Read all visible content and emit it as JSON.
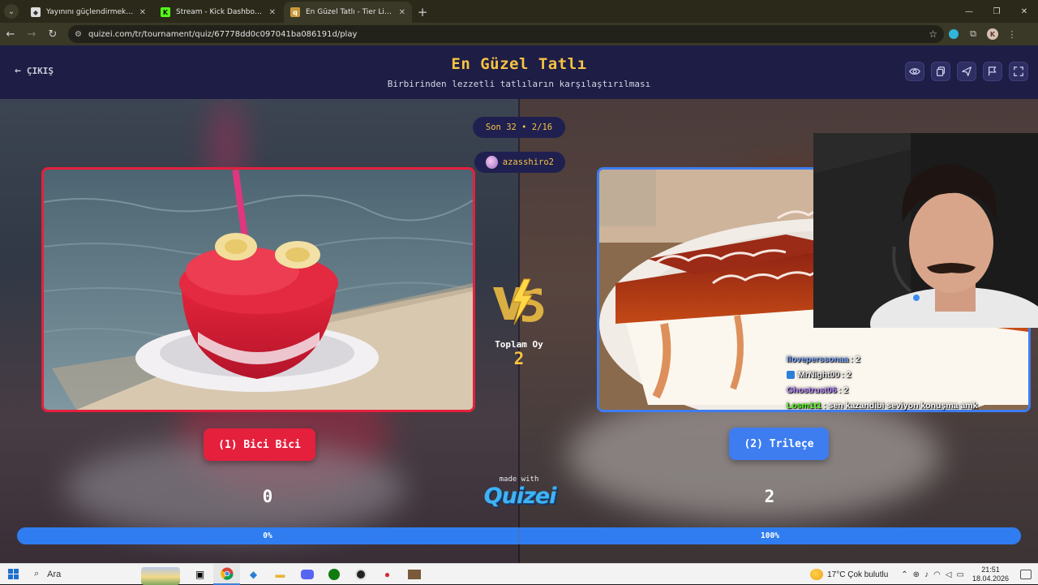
{
  "browser": {
    "tabs": [
      {
        "title": "Yayınını güçlendirmek için en iyi...",
        "favicon": "shield-icon",
        "active": false
      },
      {
        "title": "Stream - Kick Dashboard",
        "favicon": "kick-icon",
        "active": false
      },
      {
        "title": "En Güzel Tatlı - Tier List, Kör Sa...",
        "favicon": "quizei-icon",
        "active": true
      }
    ],
    "url": "quizei.com/tr/tournament/quiz/67778dd0c097041ba086191d/play"
  },
  "header": {
    "exit_label": "ÇIKIŞ",
    "title": "En Güzel Tatlı",
    "subtitle": "Birbirinden lezzetli tatlıların karşılaştırılması",
    "tools": [
      "eye-icon",
      "copy-icon",
      "send-icon",
      "flag-icon",
      "fullscreen-icon"
    ]
  },
  "match": {
    "round": "Son 32 • 2/16",
    "username": "azasshiro2",
    "total_label": "Toplam Oy",
    "total_votes": "2",
    "left": {
      "label": "(1) Bici Bici",
      "score": "0",
      "percent": "0%",
      "share": 0
    },
    "right": {
      "label": "(2) Trileçe",
      "score": "2",
      "percent": "100%",
      "share": 1
    }
  },
  "branding": {
    "made_with": "made with",
    "name": "Quizei"
  },
  "chat": [
    {
      "user": "Iloveperssonaa",
      "text": ": 2",
      "color": "#7aa7ff",
      "badge": false
    },
    {
      "user": "MrNight00",
      "text": ": 2",
      "color": "#f0f0f0",
      "badge": true
    },
    {
      "user": "Ghostrust06",
      "text": ": 2",
      "color": "#b888ff",
      "badge": false
    },
    {
      "user": "Losm1t1",
      "text": ": sen kazandibi seviyon konuşma amk",
      "color": "#53fc18",
      "badge": false
    }
  ],
  "taskbar": {
    "search_label": "Ara",
    "weather": "17°C  Çok bulutlu",
    "time": "21:51",
    "date": "18.04.2026"
  },
  "colors": {
    "accent": "#f6c343",
    "left": "#e5203d",
    "right": "#3d7df0",
    "page_bg": "#151534"
  }
}
